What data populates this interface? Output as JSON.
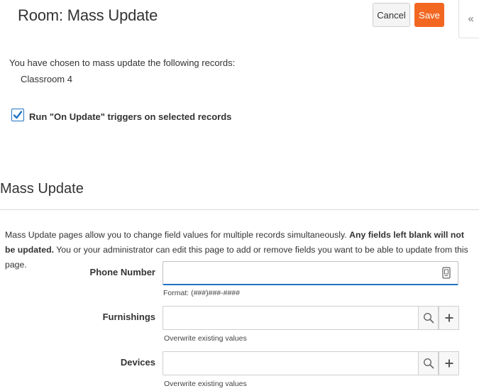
{
  "header": {
    "title": "Room: Mass Update",
    "cancel_label": "Cancel",
    "save_label": "Save",
    "collapse_symbol": "«"
  },
  "selection": {
    "intro": "You have chosen to mass update the following records:",
    "records": [
      "Classroom 4"
    ]
  },
  "triggers": {
    "checked": true,
    "label": "Run \"On Update\" triggers on selected records"
  },
  "section": {
    "title": "Mass Update",
    "description_part1": "Mass Update pages allow you to change field values for multiple records simultaneously. ",
    "description_bold": "Any fields left blank will not be updated.",
    "description_part2": " You or your administrator can edit this page to add or remove fields you want to be able to update from this page."
  },
  "fields": {
    "phone": {
      "label": "Phone Number",
      "value": "",
      "hint": "Format: (###)###-####",
      "icon": "phone-icon"
    },
    "furnishings": {
      "label": "Furnishings",
      "value": "",
      "hint": "Overwrite existing values",
      "icon": "search-icon"
    },
    "devices": {
      "label": "Devices",
      "value": "",
      "hint": "Overwrite existing values",
      "icon": "search-icon"
    }
  },
  "colors": {
    "accent": "#1f73c4",
    "save": "#f26722"
  }
}
